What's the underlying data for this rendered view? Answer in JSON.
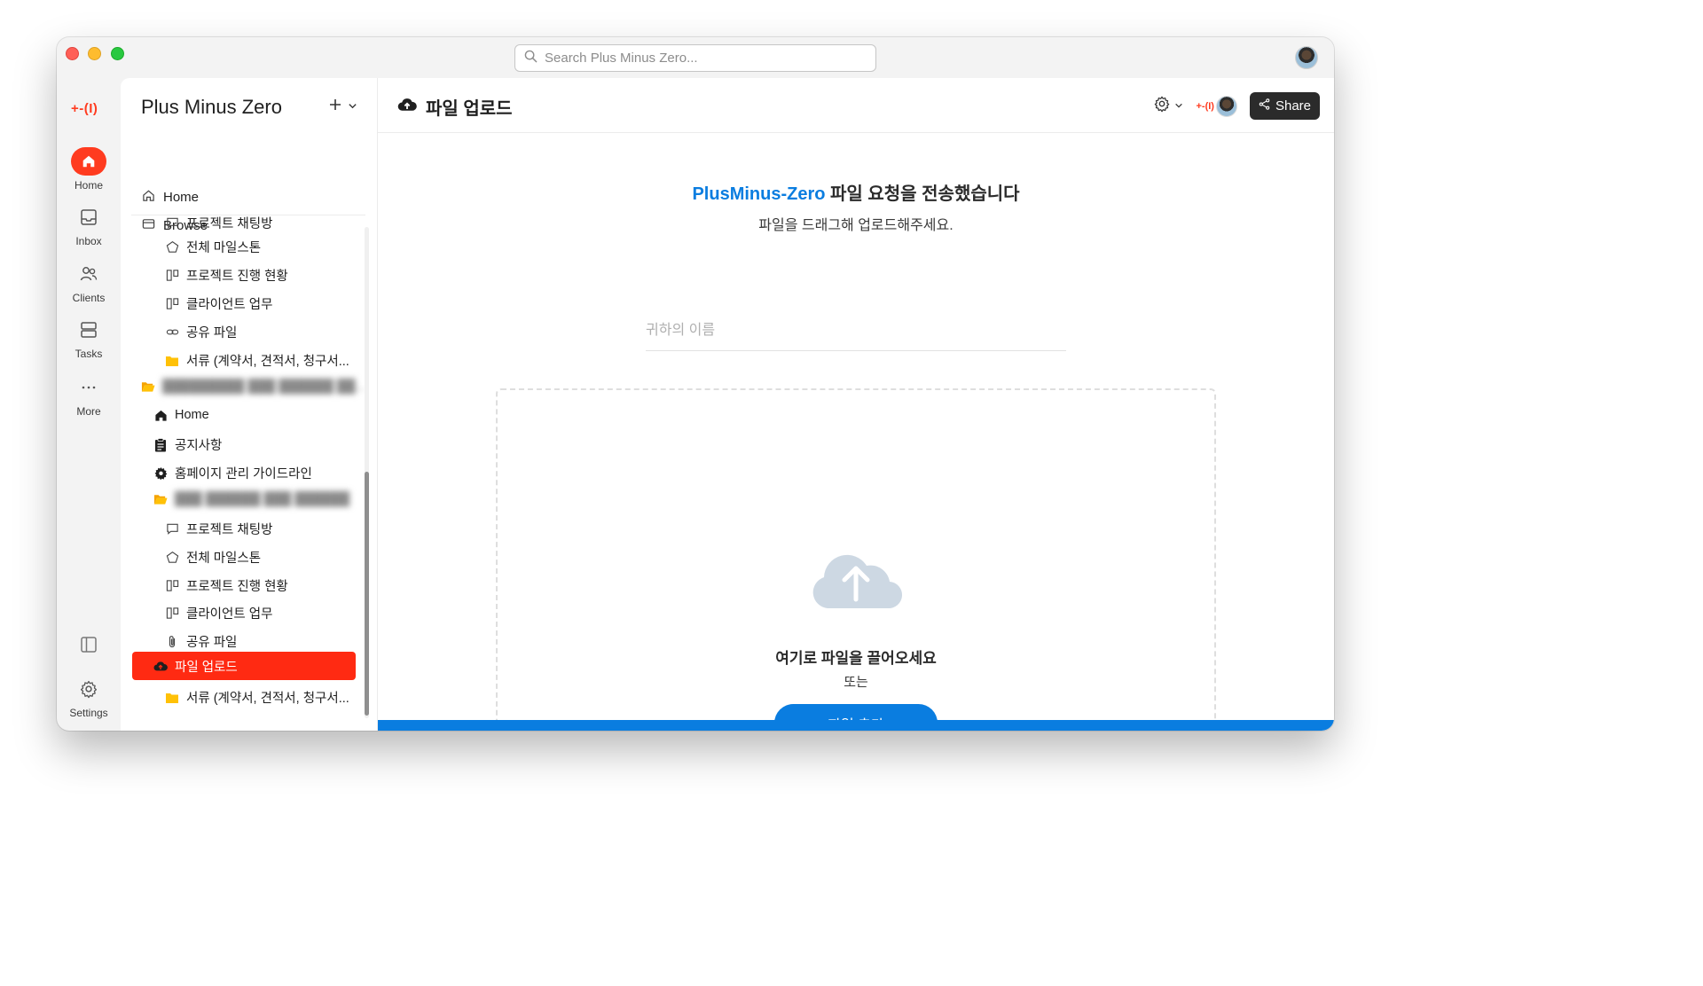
{
  "search": {
    "placeholder": "Search Plus Minus Zero..."
  },
  "rail": {
    "logo": "+-(I)",
    "items": [
      {
        "label": "Home"
      },
      {
        "label": "Inbox"
      },
      {
        "label": "Clients"
      },
      {
        "label": "Tasks"
      },
      {
        "label": "More"
      }
    ],
    "settings_label": "Settings"
  },
  "sidebar": {
    "workspace_title": "Plus Minus Zero",
    "top_nav": [
      {
        "label": "Home"
      },
      {
        "label": "Browse"
      }
    ],
    "tree": [
      {
        "label": "프로젝트 채팅방"
      },
      {
        "label": "전체 마일스톤"
      },
      {
        "label": "프로젝트 진행 현황"
      },
      {
        "label": "클라이언트 업무"
      },
      {
        "label": "공유 파일"
      },
      {
        "label": "서류 (계약서, 견적서, 청구서..."
      },
      {
        "label": "█████████ ███ ██████ ██..."
      },
      {
        "label": "Home"
      },
      {
        "label": "공지사항"
      },
      {
        "label": "홈페이지 관리 가이드라인"
      },
      {
        "label": "███ ██████ ███ ██████"
      },
      {
        "label": "프로젝트 채팅방"
      },
      {
        "label": "전체 마일스톤"
      },
      {
        "label": "프로젝트 진행 현황"
      },
      {
        "label": "클라이언트 업무"
      },
      {
        "label": "공유 파일"
      },
      {
        "label": "파일 업로드"
      },
      {
        "label": "서류 (계약서, 견적서, 청구서..."
      }
    ]
  },
  "main": {
    "title": "파일 업로드",
    "header_logo": "+-(I)",
    "share_label": "Share",
    "headline_brand": "PlusMinus-Zero",
    "headline_rest": " 파일 요청을 전송했습니다",
    "subline": "파일을 드래그해 업로드해주세요.",
    "name_placeholder": "귀하의 이름",
    "drop_title": "여기로 파일을 끌어오세요",
    "drop_or": "또는",
    "add_file_label": "파일 추가"
  },
  "colors": {
    "accent_red": "#ff2a12",
    "brand_blue": "#0a7de0",
    "share_dark": "#2b2b2b"
  }
}
